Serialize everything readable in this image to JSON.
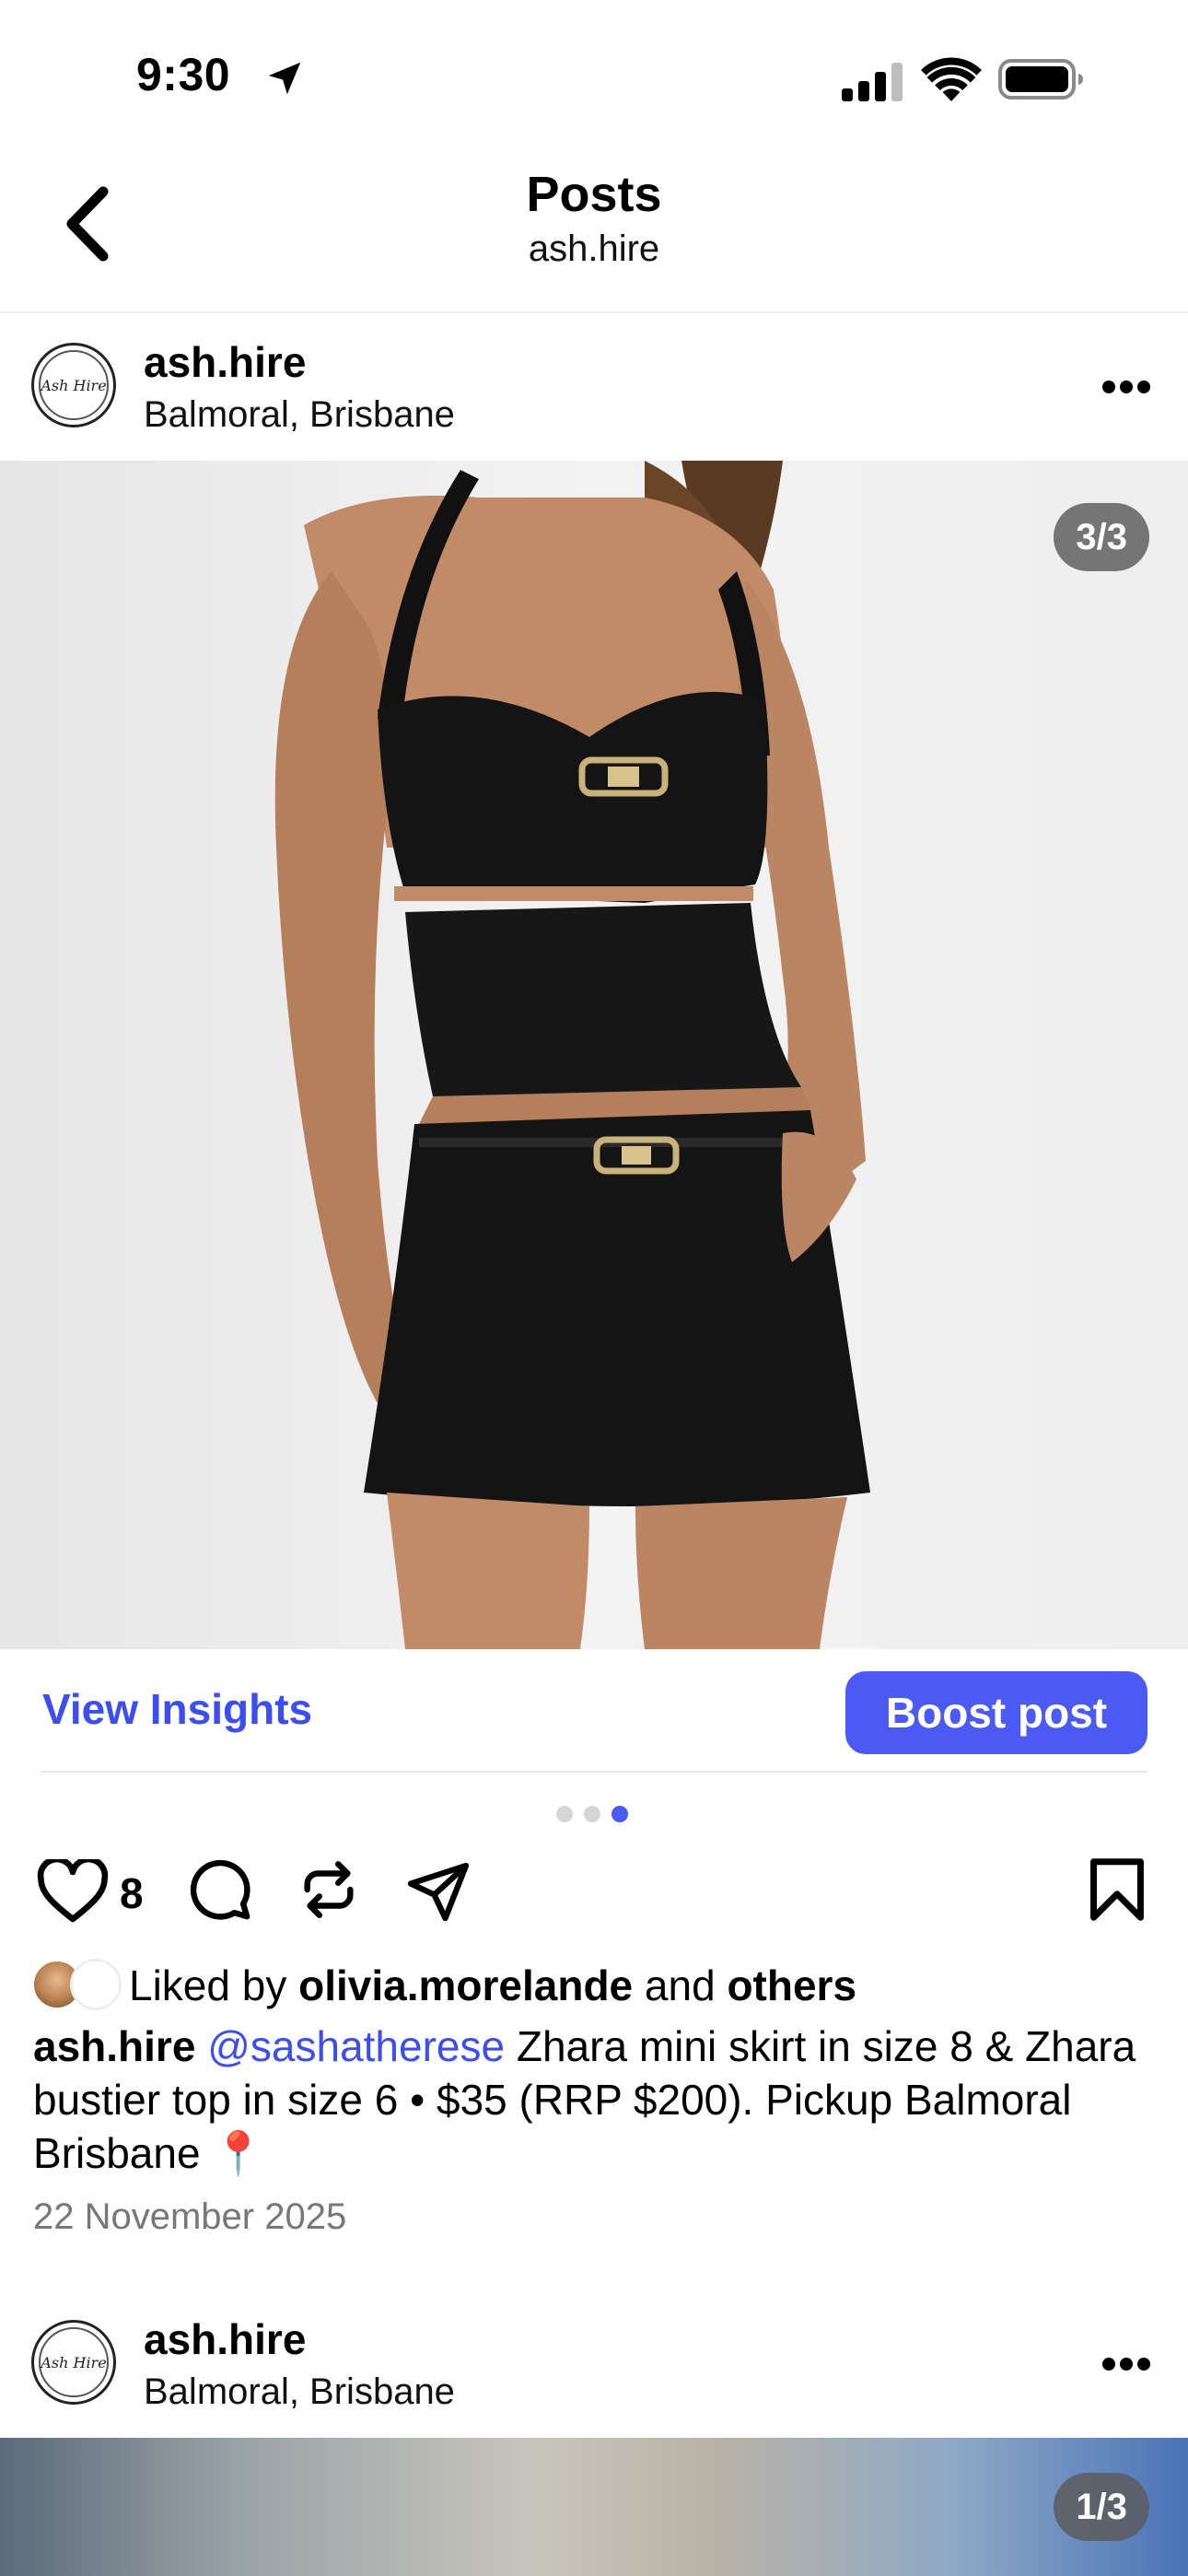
{
  "status_bar": {
    "time": "9:30"
  },
  "nav": {
    "title": "Posts",
    "subtitle": "ash.hire"
  },
  "posts": [
    {
      "username": "ash.hire",
      "location": "Balmoral, Brisbane",
      "avatar_text": "Ash Hire",
      "counter": "3/3",
      "view_insights": "View Insights",
      "boost": "Boost post",
      "likes": "8",
      "liked_prefix": "Liked by",
      "liked_user": "olivia.morelande",
      "liked_and": "and",
      "liked_others": "others",
      "caption_user": "ash.hire",
      "caption_mention": "@sashatherese",
      "caption_text": " Zhara mini skirt in size 8 & Zhara bustier top in size 6 • $35 (RRP $200). Pickup Balmoral Brisbane 📍",
      "date": "22 November 2025"
    },
    {
      "username": "ash.hire",
      "location": "Balmoral, Brisbane",
      "avatar_text": "Ash Hire",
      "counter": "1/3"
    }
  ],
  "colors": {
    "accent": "#4a5af2",
    "link": "#3d4ef0",
    "muted": "#777777"
  },
  "icons": [
    "back-chevron-icon",
    "location-arrow-icon",
    "signal-icon",
    "wifi-icon",
    "battery-icon",
    "more-icon",
    "heart-icon",
    "comment-icon",
    "repost-icon",
    "share-icon",
    "bookmark-icon"
  ]
}
